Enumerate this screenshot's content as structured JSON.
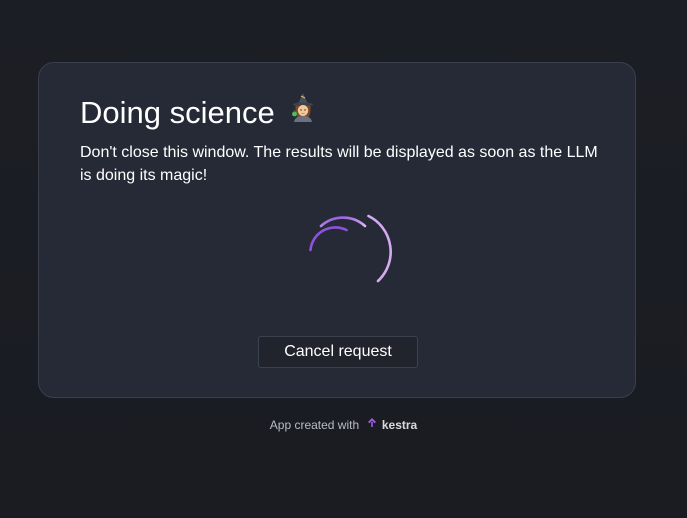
{
  "dialog": {
    "title": "Doing science",
    "title_emoji_icon": "mage-icon",
    "message": "Don't close this window. The results will be displayed as soon as the LLM is doing its magic!",
    "spinner_icon": "loading-spinner-icon",
    "cancel_label": "Cancel request"
  },
  "footer": {
    "text": "App created with",
    "brand": "kestra",
    "brand_icon": "kestra-logo-icon"
  },
  "colors": {
    "background": "#1b1d24",
    "card": "#262a36",
    "card_border": "#3a3f4c",
    "spinner_start": "#8a4fd8",
    "spinner_end": "#d9b0f2",
    "brand_accent": "#9b5de5"
  }
}
